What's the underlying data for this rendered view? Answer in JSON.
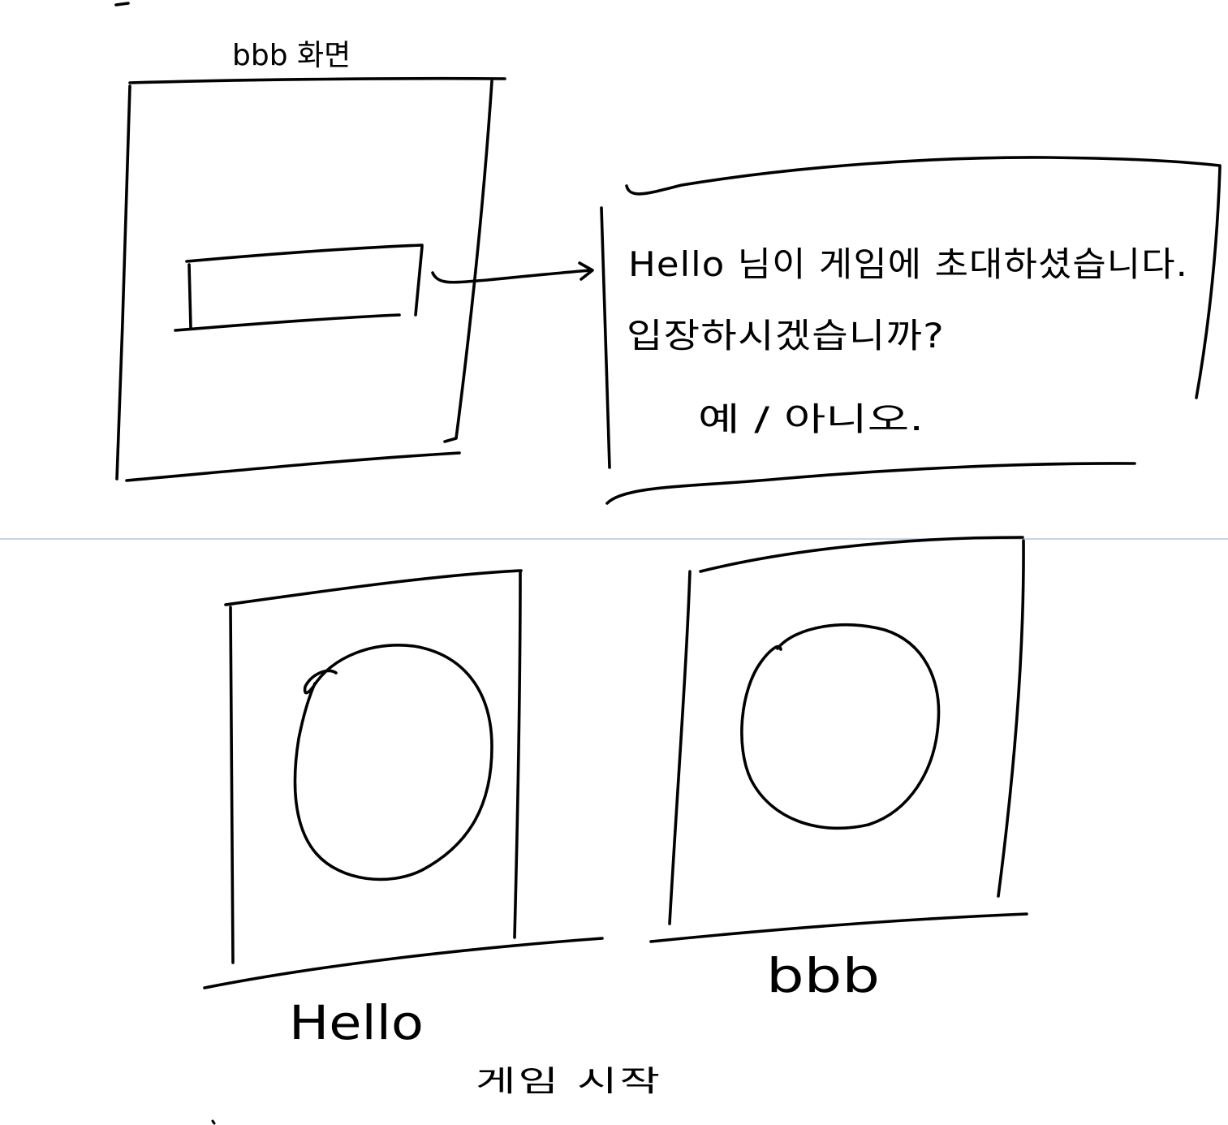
{
  "top_section": {
    "screen_title": "bbb 화면",
    "invite_dialog": {
      "message_line1": "Hello 님이 게임에 초대하셨습니다.",
      "message_line2": "입장하시겠습니까?",
      "buttons_label": "예 / 아니오."
    }
  },
  "bottom_section": {
    "player_left_name": "Hello",
    "player_right_name": "bbb",
    "game_start_label": "게임 시작"
  },
  "colors": {
    "ink": "#000000",
    "divider": "#b4c6dc",
    "background": "#ffffff"
  }
}
